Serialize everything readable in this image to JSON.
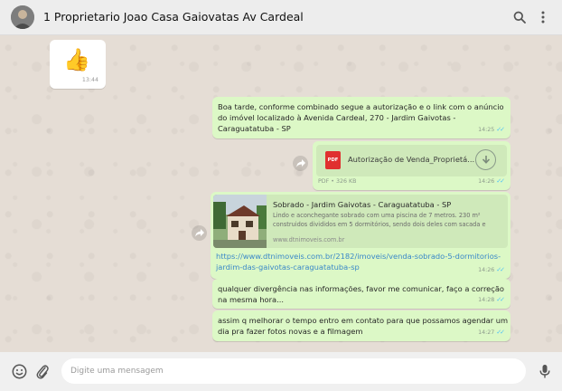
{
  "header": {
    "title": "1 Proprietario Joao Casa Gaiovatas Av Cardeal",
    "search_icon": "search-icon",
    "menu_icon": "more-vertical-icon"
  },
  "messages": {
    "thumb": {
      "emoji": "👍",
      "time": "13:44"
    },
    "m1": {
      "line1": "Boa tarde, conforme combinado segue a autorização e o link com o anúncio",
      "line2": "do imóvel localizado à Avenida Cardeal, 270 - Jardim Gaivotas -",
      "line3": "Caraguatatuba - SP",
      "time": "14:25"
    },
    "doc": {
      "type_badge": "PDF",
      "name": "Autorização de Venda_Proprietá...",
      "meta": "PDF • 326 KB",
      "time": "14:26"
    },
    "link": {
      "title": "Sobrado - Jardim Gaivotas - Caraguatatuba - SP",
      "desc": "Lindo e aconchegante sobrado com uma piscina de 7 metros. 230 m² construidos divididos em 5 dormitórios, sendo dois deles com sacada e",
      "domain": "www.dtnimoveis.com.br",
      "url": "https://www.dtnimoveis.com.br/2182/imoveis/venda-sobrado-5-dormitorios-jardim-das-gaivotas-caraguatatuba-sp",
      "time": "14:26"
    },
    "m4": {
      "line1": "qualquer divergência nas informações, favor me comunicar, faço a correção",
      "line2": "na mesma hora...",
      "time": "14:28"
    },
    "m5": {
      "line1": "assim q melhorar o tempo entro em contato para que possamos agendar um",
      "line2": "dia pra fazer fotos novas e a filmagem",
      "time": "14:27"
    }
  },
  "footer": {
    "placeholder": "Digite uma mensagem"
  },
  "colors": {
    "outgoing_bubble": "#dcf8c6",
    "incoming_bubble": "#ffffff",
    "chat_bg": "#e5ddd5",
    "link": "#3a88c8",
    "read_ticks": "#4fc3f7"
  }
}
